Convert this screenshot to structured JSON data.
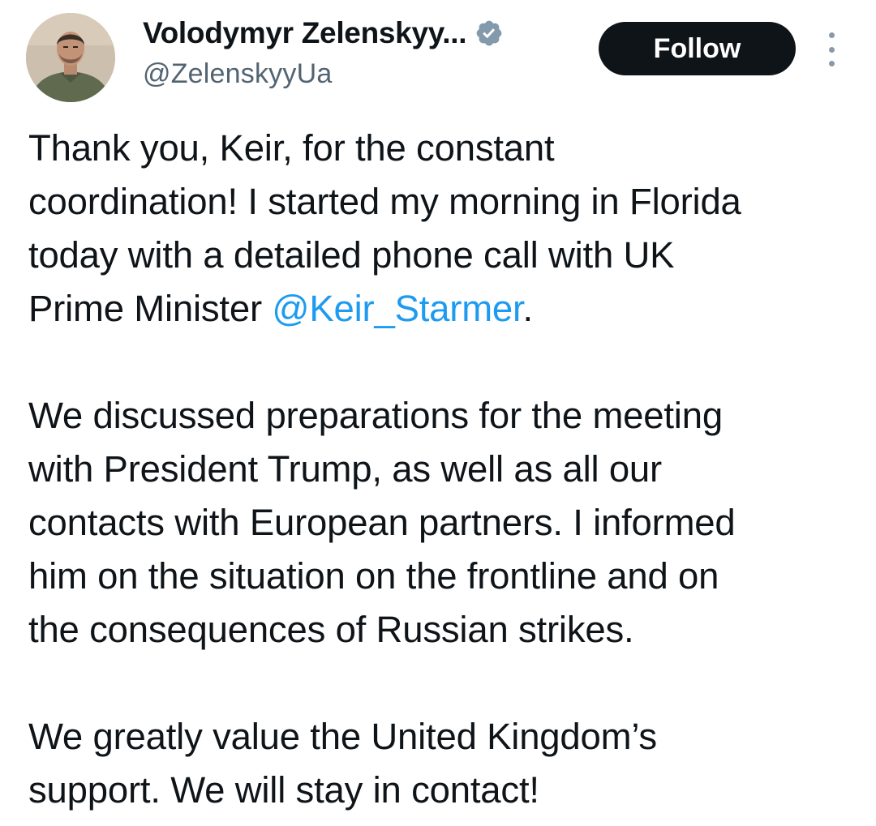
{
  "author": {
    "display_name": "Volodymyr Zelenskyy...",
    "handle": "@ZelenskyyUa",
    "verified": true,
    "avatar_icon": "profile-photo"
  },
  "actions": {
    "follow_label": "Follow",
    "more_icon": "more-vertical-icon"
  },
  "tweet": {
    "para1_line1": "Thank you, Keir, for the constant",
    "para1_line2": "coordination! I started my morning in Florida",
    "para1_line3": "today with a detailed phone call with UK",
    "para1_line4_prefix": "Prime Minister ",
    "para1_mention": "@Keir_Starmer",
    "para1_line4_suffix": ".",
    "para2_line1": "We discussed preparations for the meeting",
    "para2_line2": "with President Trump, as well as all our",
    "para2_line3": "contacts with European partners. I informed",
    "para2_line4": "him on the situation on the frontline and on",
    "para2_line5": "the consequences of Russian strikes.",
    "para3_line1": "We greatly value the United Kingdom’s",
    "para3_line2": "support. We will stay in contact!"
  },
  "colors": {
    "text": "#0f1419",
    "secondary": "#536471",
    "link": "#1d9bf0",
    "button_bg": "#0f1419",
    "button_text": "#ffffff",
    "verified_badge": "#829aab"
  }
}
